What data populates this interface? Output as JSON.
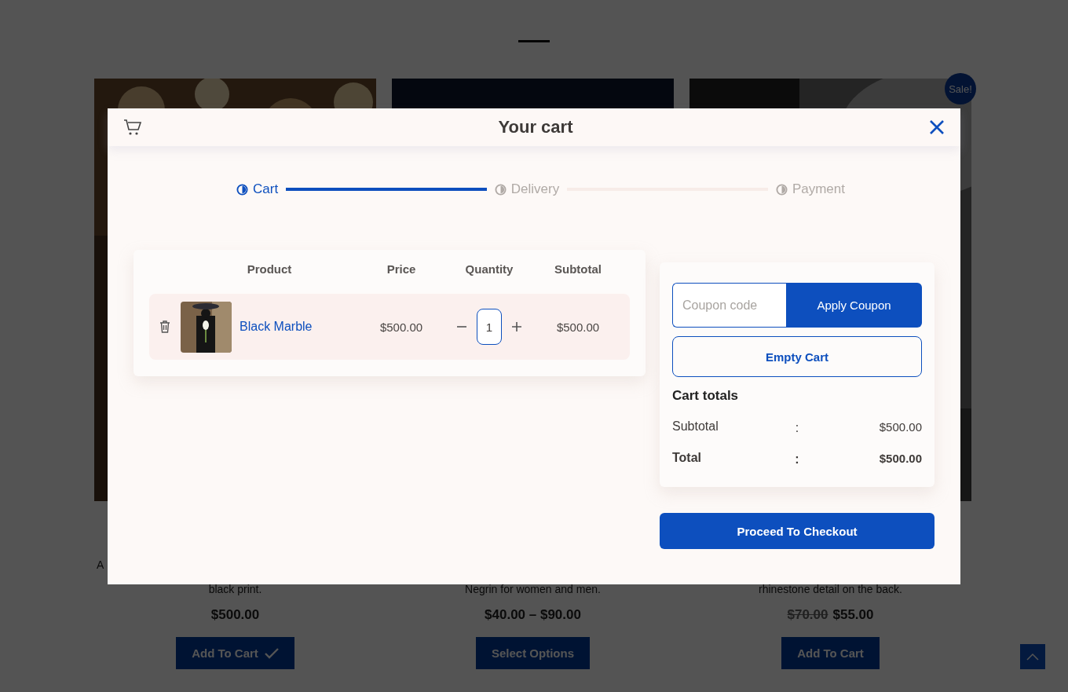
{
  "background_page": {
    "products": [
      {
        "description_lines": [
          "A",
          "black print."
        ],
        "price": "$500.00",
        "button": {
          "label": "Add To Cart",
          "added": true
        }
      },
      {
        "description_lines": [
          "Negrin for women and men."
        ],
        "price": "$40.00 – $90.00",
        "button": {
          "label": "Select Options",
          "added": false
        }
      },
      {
        "badge": "Sale!",
        "description_lines": [
          "rhinestone detail on the back."
        ],
        "old_price": "$70.00",
        "price": "$55.00",
        "button": {
          "label": "Add To Cart",
          "added": false
        }
      }
    ]
  },
  "modal": {
    "title": "Your cart",
    "steps": [
      {
        "label": "Cart",
        "selected": true
      },
      {
        "label": "Delivery",
        "selected": false
      },
      {
        "label": "Payment",
        "selected": false
      }
    ],
    "table": {
      "columns": [
        "Product",
        "Price",
        "Quantity",
        "Subtotal"
      ],
      "rows": [
        {
          "name": "Black Marble",
          "price": "$500.00",
          "quantity": "1",
          "subtotal": "$500.00"
        }
      ]
    },
    "coupon": {
      "placeholder": "Coupon code",
      "button": "Apply Coupon"
    },
    "empty_cart": "Empty Cart",
    "totals": {
      "title": "Cart totals",
      "rows": [
        {
          "kind": "normal",
          "label": "Subtotal",
          "separator": ":",
          "value": "$500.00"
        },
        {
          "kind": "bold",
          "label": "Total",
          "separator": ":",
          "value": "$500.00"
        }
      ]
    },
    "checkout": "Proceed To Checkout"
  }
}
